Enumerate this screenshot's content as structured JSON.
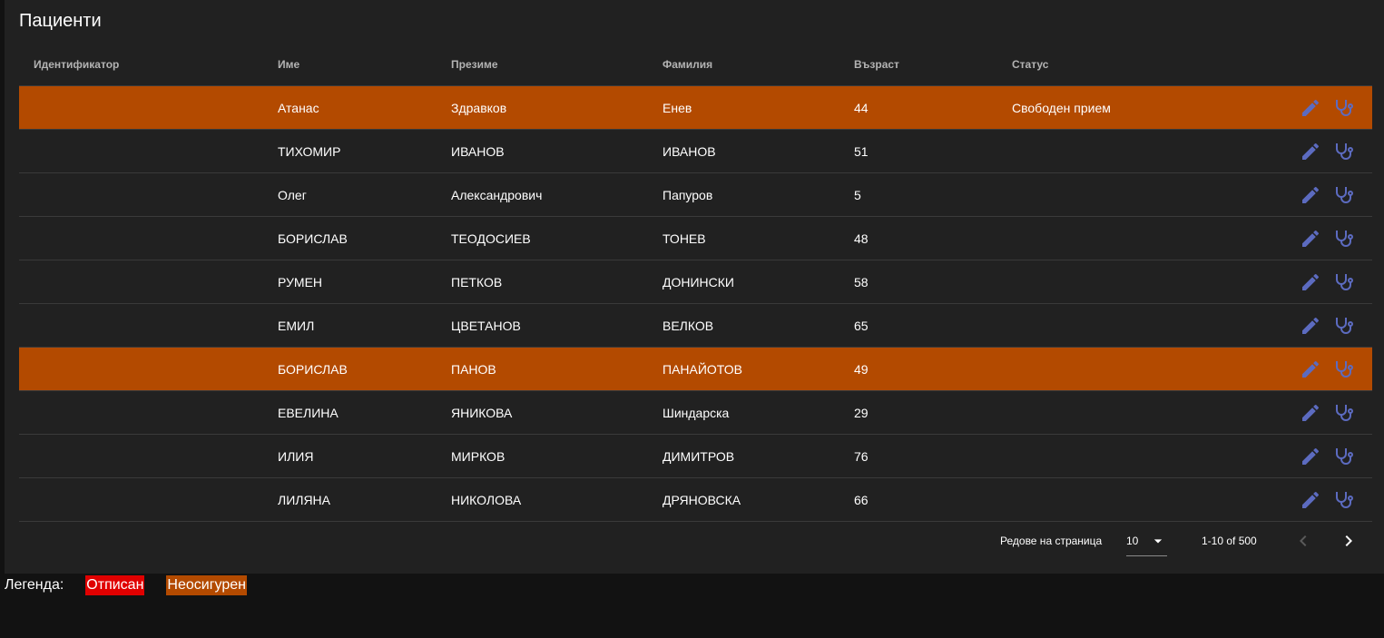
{
  "card": {
    "title": "Пациенти"
  },
  "table": {
    "columns": [
      "Идентификатор",
      "Име",
      "Презиме",
      "Фамилия",
      "Възраст",
      "Статус"
    ],
    "rows": [
      {
        "id": "",
        "first": "Атанас",
        "middle": "Здравков",
        "last": "Енев",
        "age": "44",
        "status": "Свободен прием",
        "uninsured": true
      },
      {
        "id": "",
        "first": "ТИХОМИР",
        "middle": "ИВАНОВ",
        "last": "ИВАНОВ",
        "age": "51",
        "status": "",
        "uninsured": false
      },
      {
        "id": "",
        "first": "Олег",
        "middle": "Александрович",
        "last": "Папуров",
        "age": "5",
        "status": "",
        "uninsured": false
      },
      {
        "id": "",
        "first": "БОРИСЛАВ",
        "middle": "ТЕОДОСИЕВ",
        "last": "ТОНЕВ",
        "age": "48",
        "status": "",
        "uninsured": false
      },
      {
        "id": "",
        "first": "РУМЕН",
        "middle": "ПЕТКОВ",
        "last": "ДОНИНСКИ",
        "age": "58",
        "status": "",
        "uninsured": false
      },
      {
        "id": "",
        "first": "ЕМИЛ",
        "middle": "ЦВЕТАНОВ",
        "last": "ВЕЛКОВ",
        "age": "65",
        "status": "",
        "uninsured": false
      },
      {
        "id": "",
        "first": "БОРИСЛАВ",
        "middle": "ПАНОВ",
        "last": "ПАНАЙОТОВ",
        "age": "49",
        "status": "",
        "uninsured": true
      },
      {
        "id": "",
        "first": "ЕВЕЛИНА",
        "middle": "ЯНИКОВА",
        "last": "Шиндарска",
        "age": "29",
        "status": "",
        "uninsured": false
      },
      {
        "id": "",
        "first": "ИЛИЯ",
        "middle": "МИРКОВ",
        "last": "ДИМИТРОВ",
        "age": "76",
        "status": "",
        "uninsured": false
      },
      {
        "id": "",
        "first": "ЛИЛЯНА",
        "middle": "НИКОЛОВА",
        "last": "ДРЯНОВСКА",
        "age": "66",
        "status": "",
        "uninsured": false
      }
    ],
    "row_actions": [
      "pencil-icon",
      "stethoscope-icon"
    ]
  },
  "pagination": {
    "rows_per_page_label": "Редове на страница",
    "rows_per_page_value": "10",
    "range_label": "1-10 of 500"
  },
  "legend": {
    "label": "Легенда:",
    "items": [
      {
        "text": "Отписан",
        "color": "#e00000"
      },
      {
        "text": "Неосигурен",
        "color": "#b34a00"
      }
    ]
  },
  "colors": {
    "background": "#121212",
    "card": "#212121",
    "uninsured_row": "#b34a00",
    "icon": "#5c6bc0"
  }
}
